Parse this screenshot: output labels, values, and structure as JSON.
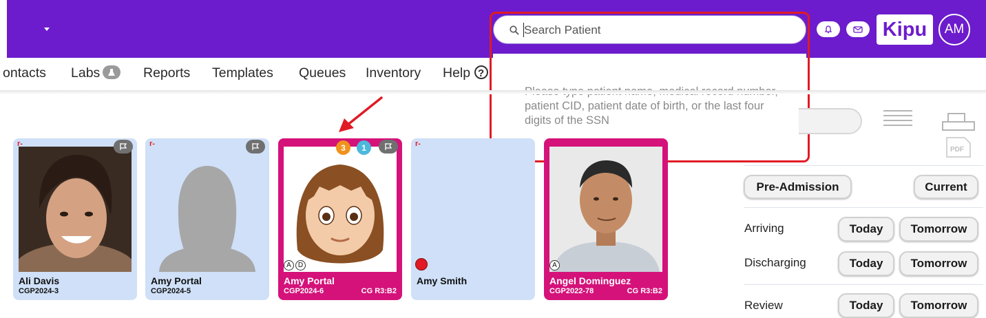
{
  "header": {
    "search_placeholder": "Search Patient",
    "search_hint": "Please type patient name, medical record number, patient CID, patient date of birth, or the last four digits of the SSN",
    "brand": "Kipu",
    "avatar_initials": "AM",
    "icons": [
      "bell-icon",
      "mail-icon",
      "search-icon"
    ]
  },
  "nav": {
    "items": [
      {
        "label": "ontacts"
      },
      {
        "label": "Labs"
      },
      {
        "label": "Reports"
      },
      {
        "label": "Templates"
      },
      {
        "label": "Queues"
      },
      {
        "label": "Inventory"
      },
      {
        "label": "Help"
      }
    ],
    "help_badge": "?"
  },
  "patients": [
    {
      "name": "Ali Davis",
      "id": "CGP2024-3",
      "room": "",
      "flag_marker": "r-"
    },
    {
      "name": "Amy Portal",
      "id": "CGP2024-5",
      "room": "",
      "flag_marker": "r-"
    },
    {
      "name": "Amy Portal",
      "id": "CGP2024-6",
      "room": "CG R3:B2",
      "badge_orange": "3",
      "badge_blue": "1",
      "status_a": "A",
      "status_d": "D"
    },
    {
      "name": "Amy Smith",
      "id": "",
      "room": "",
      "flag_marker": "r-"
    },
    {
      "name": "Angel Dominguez",
      "id": "CGP2022-78",
      "room": "CG R3:B2",
      "status_a": "A"
    }
  ],
  "sidebar": {
    "pre_admission": "Pre-Admission",
    "current": "Current",
    "arriving": "Arriving",
    "discharging": "Discharging",
    "review": "Review",
    "today": "Today",
    "tomorrow": "Tomorrow",
    "pdf_label": "PDF"
  },
  "colors": {
    "header_bg": "#6c1ccc",
    "card_blue": "#cfe0f8",
    "card_pink": "#d4127a",
    "highlight_red": "#e01b24",
    "badge_orange": "#f0921e",
    "badge_blue": "#4cb8dc"
  }
}
